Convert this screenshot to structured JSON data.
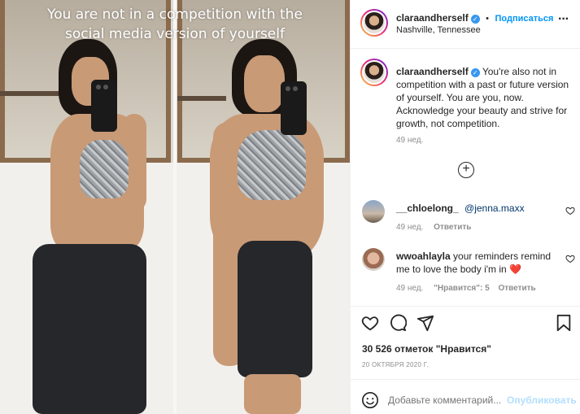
{
  "photo": {
    "overlay_line1": "You are not in a competition with the",
    "overlay_line2": "social media version of yourself"
  },
  "header": {
    "username": "claraandherself",
    "dot": "•",
    "follow_label": "Подписаться",
    "location": "Nashville, Tennessee",
    "more_label": "···"
  },
  "caption": {
    "username": "claraandherself",
    "text": "You're also not in competition with a past or future version of yourself. You are you, now. Acknowledge your beauty and strive for growth, not competition.",
    "time": "49 нед."
  },
  "load_more": "+",
  "comments": [
    {
      "username": "__chloelong_",
      "text": "@jenna.maxx",
      "time": "49 нед.",
      "reply_label": "Ответить"
    },
    {
      "username": "wwoahlayla",
      "text": "your reminders remind me to love the body i'm in",
      "emoji": "❤️",
      "time": "49 нед.",
      "likes_label": "\"Нравится\": 5",
      "reply_label": "Ответить"
    }
  ],
  "likes": {
    "count_text": "30 526 отметок \"Нравится\"",
    "date": "20 ОКТЯБРЯ 2020 Г."
  },
  "comment_box": {
    "placeholder": "Добавьте комментарий...",
    "publish_label": "Опубликовать"
  },
  "colors": {
    "link_blue": "#0095f6",
    "verified_blue": "#3897f0",
    "heart_red": "#ed4956"
  },
  "icons": [
    "verified-icon",
    "more-icon",
    "add-circle-icon",
    "heart-icon",
    "comment-icon",
    "share-icon",
    "bookmark-icon",
    "emoji-icon"
  ]
}
